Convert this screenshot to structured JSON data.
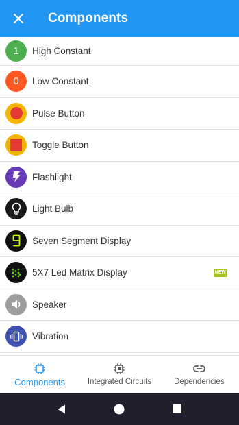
{
  "app_bar": {
    "title": "Components",
    "close_icon": "close-icon"
  },
  "colors": {
    "primary": "#2196f3",
    "nav_background": "#1f1f2e",
    "new_badge": "#a5c21b"
  },
  "components": [
    {
      "label": "High Constant",
      "icon": "high-constant-icon",
      "glyph": "1",
      "color": "#4caf50"
    },
    {
      "label": "Low Constant",
      "icon": "low-constant-icon",
      "glyph": "0",
      "color": "#ff5722"
    },
    {
      "label": "Pulse Button",
      "icon": "pulse-button-icon",
      "color": "#f5b400",
      "inner": "#e53935"
    },
    {
      "label": "Toggle Button",
      "icon": "toggle-button-icon",
      "color": "#f5b400",
      "inner": "#e53935"
    },
    {
      "label": "Flashlight",
      "icon": "flashlight-icon",
      "color": "#673ab7"
    },
    {
      "label": "Light Bulb",
      "icon": "light-bulb-icon",
      "color": "#1a1a1a"
    },
    {
      "label": "Seven Segment Display",
      "icon": "seven-segment-icon",
      "color": "#111111",
      "accent": "#c6ff00"
    },
    {
      "label": "5X7 Led Matrix Display",
      "icon": "led-matrix-icon",
      "color": "#111111",
      "accent": "#64dd17",
      "badge": "NEW"
    },
    {
      "label": "Speaker",
      "icon": "speaker-icon",
      "color": "#9e9e9e"
    },
    {
      "label": "Vibration",
      "icon": "vibration-icon",
      "color": "#3f51b5"
    }
  ],
  "bottom_nav": {
    "tabs": [
      {
        "label": "Components",
        "icon": "chip-icon",
        "active": true
      },
      {
        "label": "Integrated Circuits",
        "icon": "integrated-circuit-icon",
        "active": false
      },
      {
        "label": "Dependencies",
        "icon": "link-icon",
        "active": false
      }
    ]
  },
  "system_nav": {
    "buttons": [
      "back-icon",
      "home-icon",
      "recents-icon"
    ]
  }
}
